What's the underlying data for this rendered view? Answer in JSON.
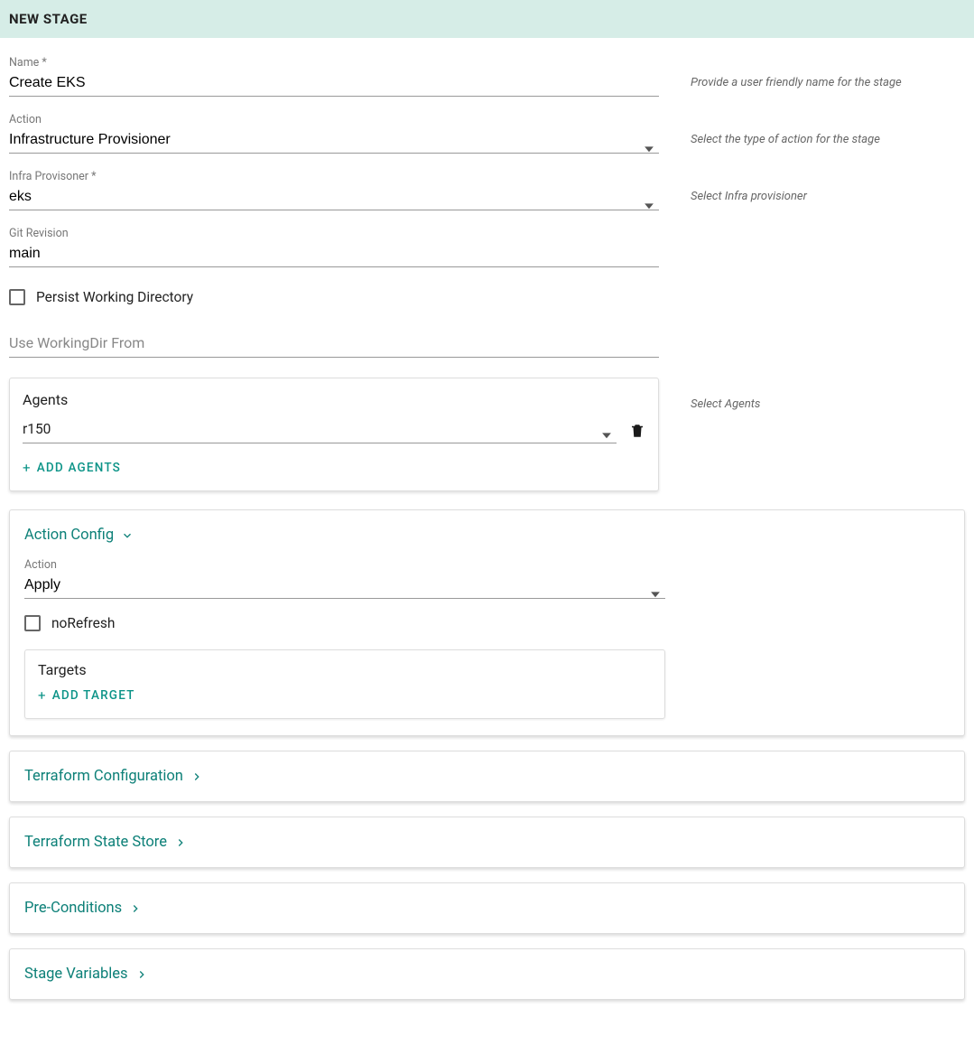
{
  "header": {
    "title": "NEW STAGE"
  },
  "fields": {
    "name": {
      "label": "Name *",
      "value": "Create EKS",
      "hint": "Provide a user friendly name for the stage"
    },
    "action": {
      "label": "Action",
      "value": "Infrastructure Provisioner",
      "hint": "Select the type of action for the stage"
    },
    "infra": {
      "label": "Infra Provisoner *",
      "value": "eks",
      "hint": "Select Infra provisioner"
    },
    "git": {
      "label": "Git Revision",
      "value": "main"
    },
    "persist": {
      "label": "Persist Working Directory"
    },
    "workdir": {
      "placeholder": "Use WorkingDir From"
    }
  },
  "agents": {
    "title": "Agents",
    "selected": "r150",
    "add_label": "ADD  AGENTS",
    "hint": "Select Agents"
  },
  "action_config": {
    "title": "Action Config",
    "action_label": "Action",
    "action_value": "Apply",
    "norefresh_label": "noRefresh",
    "targets_title": "Targets",
    "add_target_label": "ADD  TARGET"
  },
  "panels": {
    "terraform_config": "Terraform Configuration",
    "terraform_state": "Terraform State Store",
    "preconditions": "Pre-Conditions",
    "stage_vars": "Stage Variables"
  }
}
